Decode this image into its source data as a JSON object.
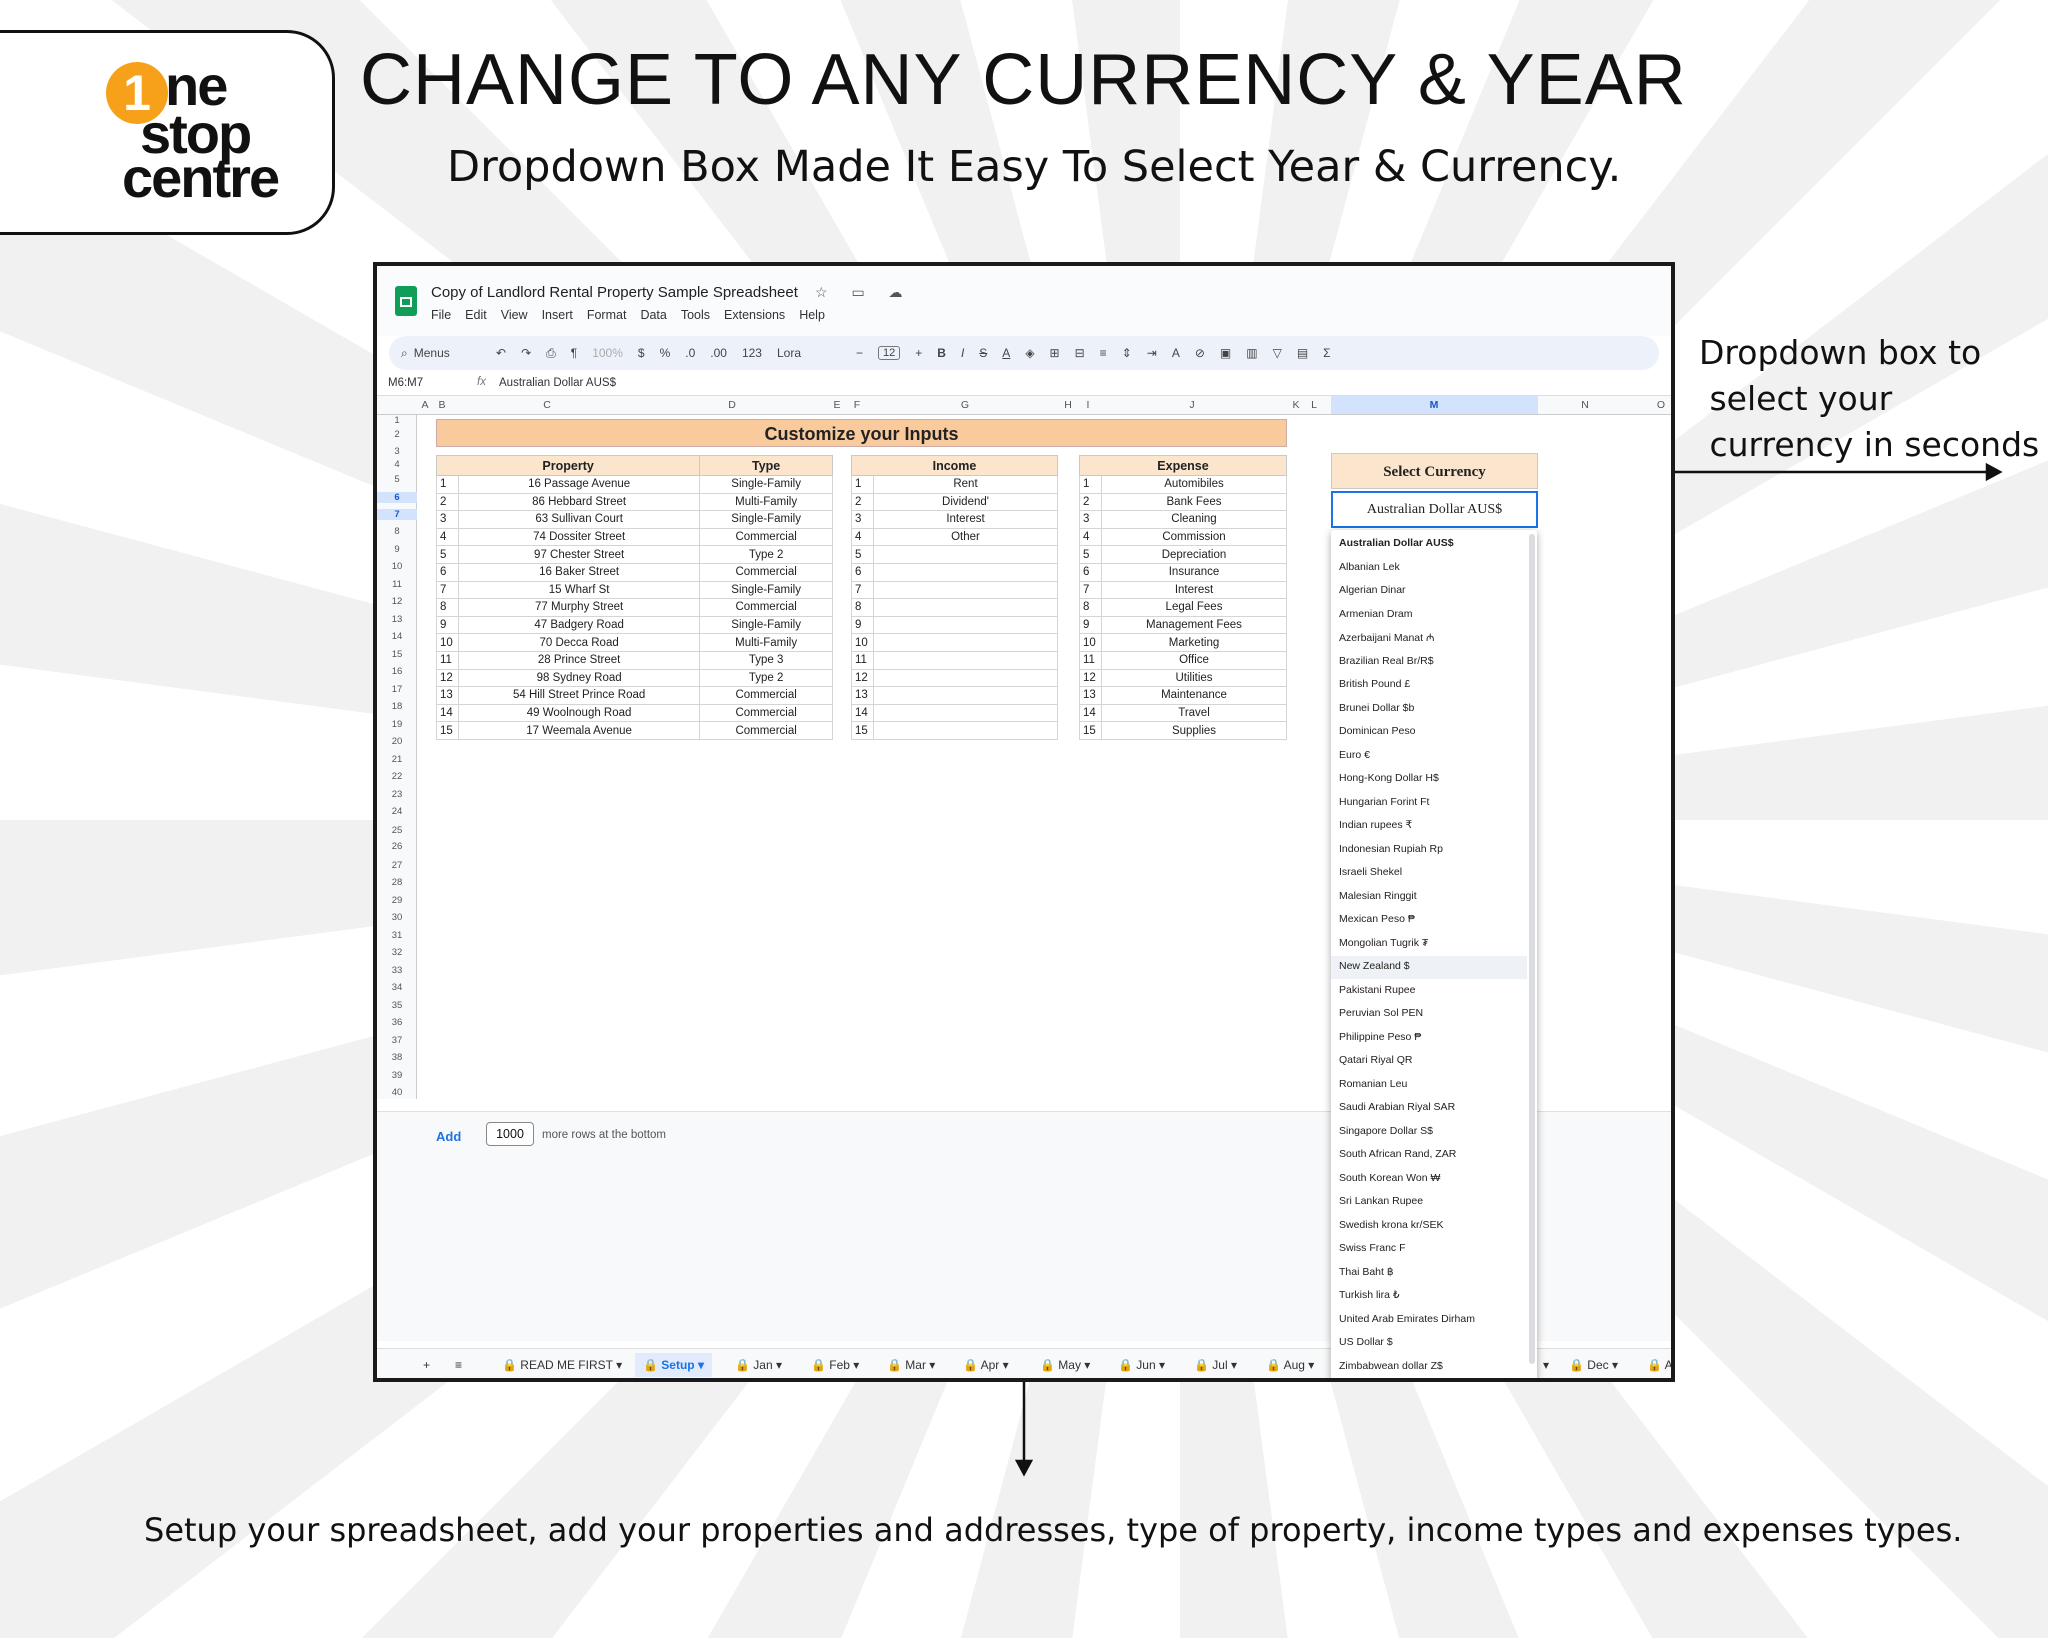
{
  "logo": {
    "one": "1",
    "line1": "ne",
    "line2": "stop",
    "line3": "centre"
  },
  "headline": "CHANGE TO ANY CURRENCY & YEAR",
  "subheadline": "Dropdown Box Made It Easy To Select Year & Currency.",
  "callout": "Dropdown box to\n select your\n currency in seconds",
  "caption": "Setup your spreadsheet, add your properties and addresses, type of property, income types and expenses types.",
  "sheet": {
    "title": "Copy of Landlord Rental Property Sample Spreadsheet",
    "title_icons": "☆ ▭ ☁",
    "menu": [
      "File",
      "Edit",
      "View",
      "Insert",
      "Format",
      "Data",
      "Tools",
      "Extensions",
      "Help"
    ],
    "toolbar": {
      "search": "Menus",
      "zoom": "100%",
      "currency": "$",
      "percent": "%",
      "dec_minus": ".0",
      "dec_plus": ".00",
      "num_format": "123",
      "font": "Lora",
      "font_size": "12"
    },
    "name_box": "M6:M7",
    "fx_icon": "fx",
    "formula_value": "Australian Dollar AUS$",
    "columns": [
      "A",
      "B",
      "C",
      "D",
      "E",
      "F",
      "G",
      "H",
      "I",
      "J",
      "K",
      "L",
      "M",
      "N",
      "O"
    ],
    "rows": [
      "1",
      "2",
      "3",
      "4",
      "5",
      "6",
      "7",
      "8",
      "9",
      "10",
      "11",
      "12",
      "13",
      "14",
      "15",
      "16",
      "17",
      "18",
      "19",
      "20",
      "21",
      "22",
      "23",
      "24",
      "25",
      "26",
      "27",
      "28",
      "29",
      "30",
      "31",
      "32",
      "33",
      "34",
      "35",
      "36",
      "37",
      "38",
      "39",
      "40"
    ],
    "banner": "Customize your Inputs",
    "property_table": {
      "headers": [
        "Property",
        "Type"
      ],
      "rows": [
        [
          "1",
          "16 Passage Avenue",
          "Single-Family"
        ],
        [
          "2",
          "86 Hebbard Street",
          "Multi-Family"
        ],
        [
          "3",
          "63 Sullivan Court",
          "Single-Family"
        ],
        [
          "4",
          "74 Dossiter Street",
          "Commercial"
        ],
        [
          "5",
          "97 Chester Street",
          "Type 2"
        ],
        [
          "6",
          "16 Baker Street",
          "Commercial"
        ],
        [
          "7",
          "15 Wharf St",
          "Single-Family"
        ],
        [
          "8",
          "77 Murphy Street",
          "Commercial"
        ],
        [
          "9",
          "47 Badgery Road",
          "Single-Family"
        ],
        [
          "10",
          "70 Decca Road",
          "Multi-Family"
        ],
        [
          "11",
          "28 Prince Street",
          "Type 3"
        ],
        [
          "12",
          "98 Sydney Road",
          "Type 2"
        ],
        [
          "13",
          "54 Hill Street Prince Road",
          "Commercial"
        ],
        [
          "14",
          "49 Woolnough Road",
          "Commercial"
        ],
        [
          "15",
          "17 Weemala Avenue",
          "Commercial"
        ]
      ]
    },
    "income_table": {
      "header": "Income",
      "rows": [
        [
          "1",
          "Rent"
        ],
        [
          "2",
          "Dividend'"
        ],
        [
          "3",
          "Interest"
        ],
        [
          "4",
          "Other"
        ],
        [
          "5",
          ""
        ],
        [
          "6",
          ""
        ],
        [
          "7",
          ""
        ],
        [
          "8",
          ""
        ],
        [
          "9",
          ""
        ],
        [
          "10",
          ""
        ],
        [
          "11",
          ""
        ],
        [
          "12",
          ""
        ],
        [
          "13",
          ""
        ],
        [
          "14",
          ""
        ],
        [
          "15",
          ""
        ]
      ]
    },
    "expense_table": {
      "header": "Expense",
      "rows": [
        [
          "1",
          "Automibiles"
        ],
        [
          "2",
          "Bank Fees"
        ],
        [
          "3",
          "Cleaning"
        ],
        [
          "4",
          "Commission"
        ],
        [
          "5",
          "Depreciation"
        ],
        [
          "6",
          "Insurance"
        ],
        [
          "7",
          "Interest"
        ],
        [
          "8",
          "Legal Fees"
        ],
        [
          "9",
          "Management Fees"
        ],
        [
          "10",
          "Marketing"
        ],
        [
          "11",
          "Office"
        ],
        [
          "12",
          "Utilities"
        ],
        [
          "13",
          "Maintenance"
        ],
        [
          "14",
          "Travel"
        ],
        [
          "15",
          "Supplies"
        ]
      ]
    },
    "currency": {
      "header": "Select Currency",
      "selected": "Australian Dollar AUS$",
      "highlighted": "New Zealand $",
      "options": [
        "Australian Dollar AUS$",
        "Albanian Lek",
        "Algerian Dinar",
        "Armenian Dram",
        "Azerbaijani Manat ₼",
        "Brazilian Real Br/R$",
        "British Pound £",
        "Brunei Dollar $b",
        "Dominican Peso",
        "Euro €",
        "Hong-Kong Dollar H$",
        "Hungarian Forint Ft",
        "Indian rupees ₹",
        "Indonesian Rupiah Rp",
        "Israeli Shekel",
        "Malesian Ringgit",
        "Mexican Peso ₱",
        "Mongolian Tugrik ₮",
        "New Zealand $",
        "Pakistani Rupee",
        "Peruvian Sol PEN",
        "Philippine Peso ₱",
        "Qatari Riyal QR",
        "Romanian Leu",
        "Saudi Arabian Riyal SAR",
        "Singapore Dollar S$",
        "South African Rand, ZAR",
        "South Korean Won ₩",
        "Sri Lankan Rupee",
        "Swedish krona kr/SEK",
        "Swiss Franc F",
        "Thai Baht ฿",
        "Turkish lira ₺",
        "United Arab Emirates Dirham",
        "US Dollar $",
        "Zimbabwean dollar Z$"
      ]
    },
    "add_rows": {
      "button": "Add",
      "count": "1000",
      "text": "more rows at the bottom"
    },
    "tabs": [
      "+",
      "≡",
      "🔒 READ ME FIRST ▾",
      "🔒 Setup ▾",
      "🔒 Jan ▾",
      "🔒 Feb ▾",
      "🔒 Mar ▾",
      "🔒 Apr ▾",
      "🔒 May ▾",
      "🔒 Jun ▾",
      "🔒 Jul ▾",
      "🔒 Aug ▾",
      "▾",
      "🔒 Dec ▾",
      "🔒 A"
    ]
  }
}
